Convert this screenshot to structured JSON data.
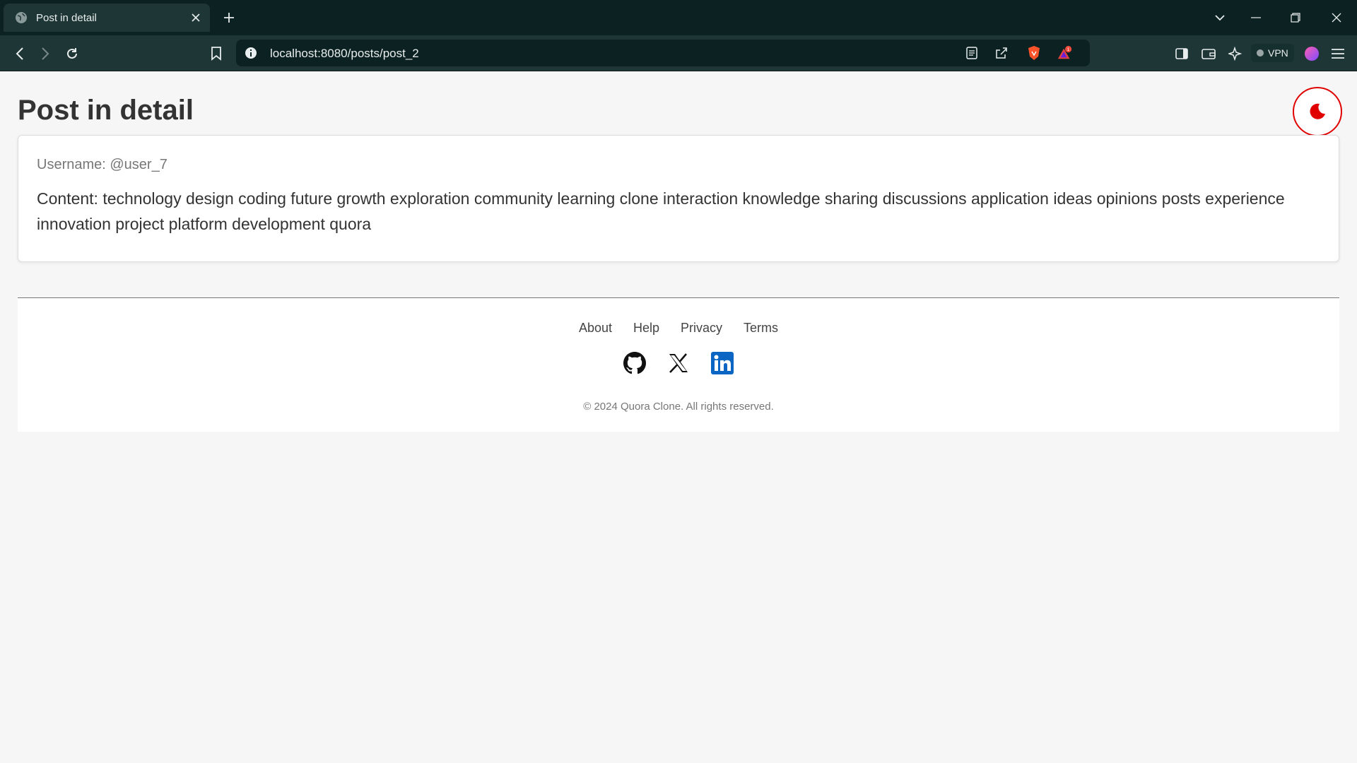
{
  "browser": {
    "tab": {
      "title": "Post in detail"
    },
    "url": "localhost:8080/posts/post_2",
    "vpn_label": "VPN",
    "notification_count": "1"
  },
  "page": {
    "title": "Post in detail",
    "post": {
      "username": "Username: @user_7",
      "content": "Content: technology design coding future growth exploration community learning clone interaction knowledge sharing discussions application ideas opinions posts experience innovation project platform development quora"
    },
    "footer": {
      "links": [
        "About",
        "Help",
        "Privacy",
        "Terms"
      ],
      "social": [
        "github-icon",
        "x-icon",
        "linkedin-icon"
      ],
      "copyright": "© 2024 Quora Clone. All rights reserved."
    }
  },
  "colors": {
    "accent_red": "#e00000",
    "chrome_dark": "#0c2121",
    "chrome_toolbar": "#1e3636",
    "linkedin_blue": "#0a66c2"
  }
}
